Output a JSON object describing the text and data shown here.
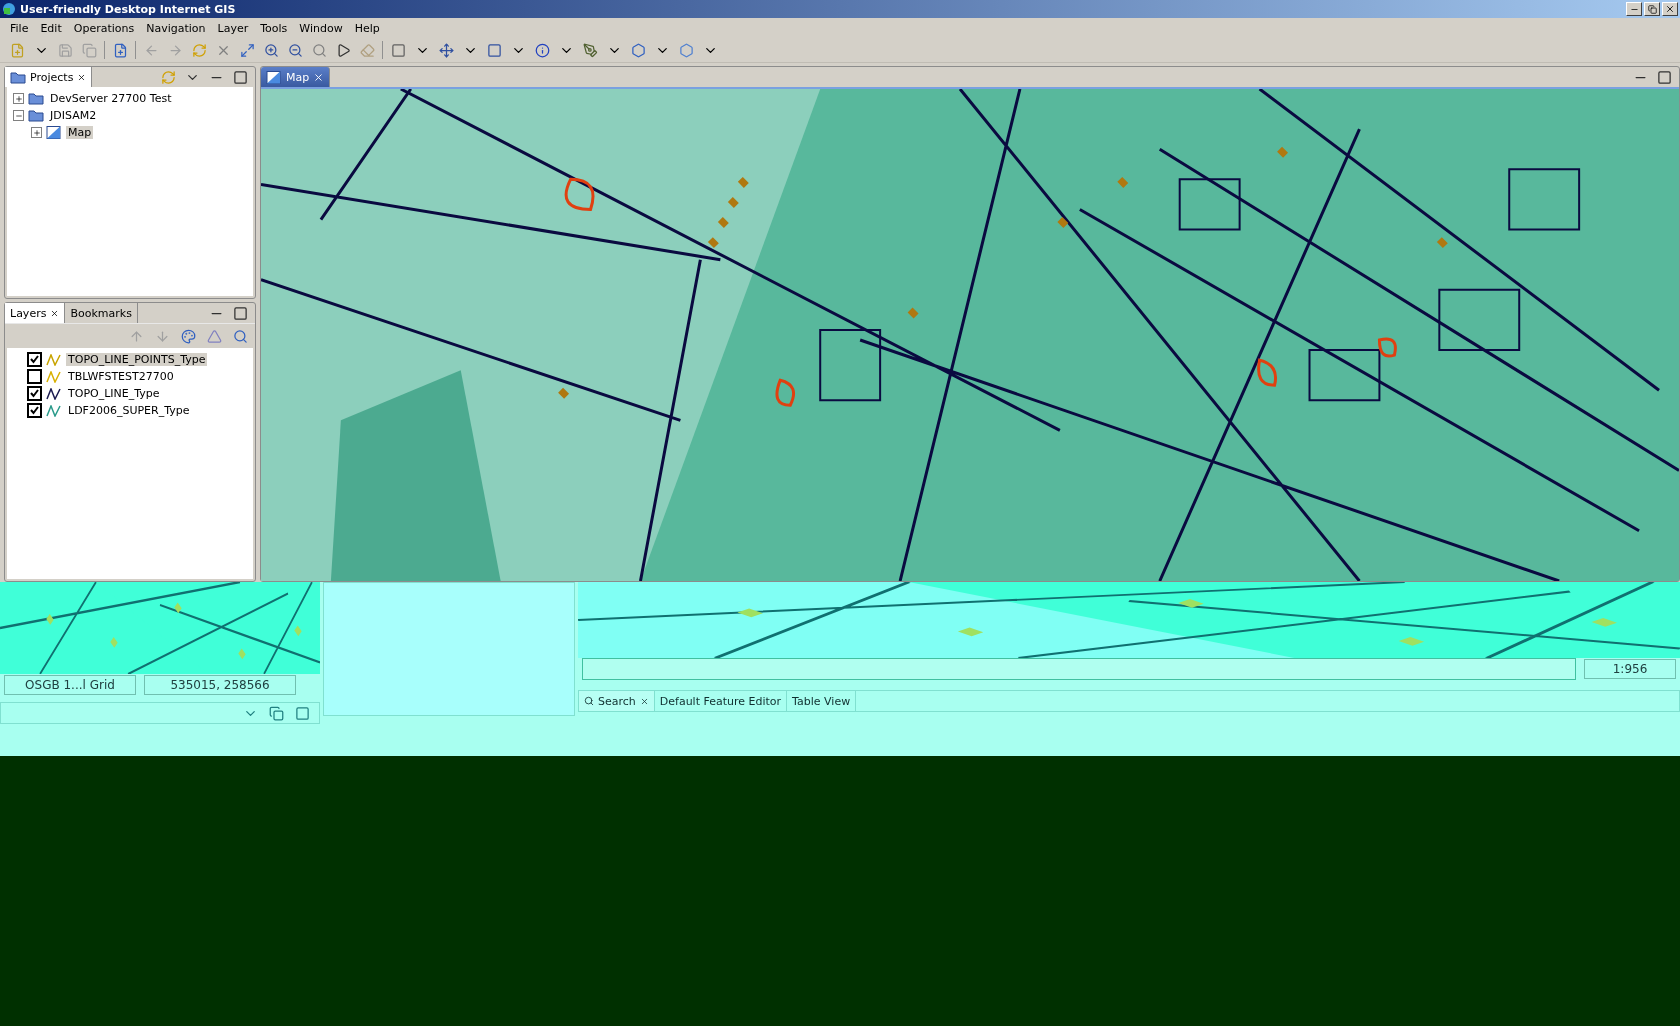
{
  "window": {
    "title": "User-friendly Desktop Internet GIS"
  },
  "menu": [
    {
      "label": "File"
    },
    {
      "label": "Edit"
    },
    {
      "label": "Operations"
    },
    {
      "label": "Navigation"
    },
    {
      "label": "Layer"
    },
    {
      "label": "Tools"
    },
    {
      "label": "Window"
    },
    {
      "label": "Help"
    }
  ],
  "projects_view": {
    "tab": "Projects",
    "tree": [
      {
        "label": "DevServer 27700 Test",
        "expanded": false,
        "selected": false
      },
      {
        "label": "JDISAM2",
        "expanded": true,
        "selected": false,
        "children": [
          {
            "label": "Map",
            "expanded": false,
            "selected": true
          }
        ]
      }
    ]
  },
  "layers_view": {
    "tabs": [
      {
        "label": "Layers",
        "selected": true
      },
      {
        "label": "Bookmarks",
        "selected": false
      }
    ],
    "layers": [
      {
        "name": "TOPO_LINE_POINTS_Type",
        "checked": true,
        "selected": true,
        "color": "#c8a400"
      },
      {
        "name": "TBLWFSTEST27700",
        "checked": false,
        "selected": false,
        "color": "#d8b000"
      },
      {
        "name": "TOPO_LINE_Type",
        "checked": true,
        "selected": false,
        "color": "#1a1a50"
      },
      {
        "name": "LDF2006_SUPER_Type",
        "checked": true,
        "selected": false,
        "color": "#2a9a8a"
      }
    ]
  },
  "map_editor": {
    "tab": "Map"
  },
  "status_bar": {
    "crs": "OSGB 1...l Grid",
    "coordinates": "535015, 258566",
    "scale": "1:956"
  },
  "bottom_tabs": [
    {
      "label": "Search",
      "selected": true
    },
    {
      "label": "Default Feature Editor",
      "selected": false
    },
    {
      "label": "Table View",
      "selected": false
    }
  ]
}
